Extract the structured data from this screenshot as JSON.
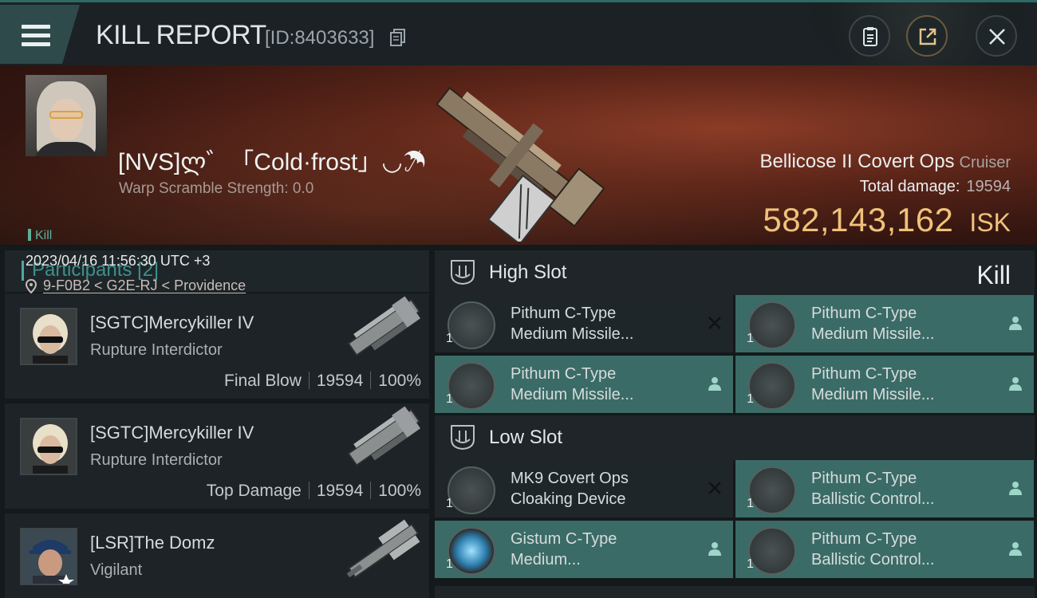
{
  "header": {
    "title": "KILL REPORT",
    "report_id": "[ID:8403633]",
    "menu_icon": "hamburger-menu-icon",
    "buttons": [
      "clipboard-icon",
      "share-icon",
      "close-icon"
    ]
  },
  "victim": {
    "name": "[NVS]ლ゛「Cold·frost」◡☂",
    "warp_scramble": "Warp Scramble Strength: 0.0",
    "type_tag": "Kill",
    "datetime": "2023/04/16 11:56:30 UTC +3",
    "location": "9-F0B2 < G2E-RJ < Providence",
    "ship": "Bellicose II Covert Ops",
    "ship_class": "Cruiser",
    "total_damage_label": "Total damage:",
    "total_damage": "19594",
    "isk_value": "582,143,162",
    "isk_unit": "ISK",
    "result": "Kill"
  },
  "participants": {
    "label": "Participants",
    "count": "[2]",
    "items": [
      {
        "name": "[SGTC]Mercykiller IV",
        "ship": "Rupture Interdictor",
        "tag": "Final Blow",
        "damage": "19594",
        "percent": "100%"
      },
      {
        "name": "[SGTC]Mercykiller IV",
        "ship": "Rupture Interdictor",
        "tag": "Top Damage",
        "damage": "19594",
        "percent": "100%"
      },
      {
        "name": "[LSR]The Domz",
        "ship": "Vigilant"
      }
    ]
  },
  "slots": {
    "high": {
      "label": "High Slot",
      "modules": [
        {
          "line1": "Pithum C-Type",
          "line2": "Medium Missile...",
          "qty": "1",
          "action": "close-x-icon"
        },
        {
          "line1": "Pithum C-Type",
          "line2": "Medium Missile...",
          "qty": "1",
          "action": "person-icon"
        },
        {
          "line1": "Pithum C-Type",
          "line2": "Medium Missile...",
          "qty": "1",
          "action": "person-icon"
        },
        {
          "line1": "Pithum C-Type",
          "line2": "Medium Missile...",
          "qty": "1",
          "action": "person-icon"
        }
      ]
    },
    "low": {
      "label": "Low Slot",
      "modules": [
        {
          "line1": "MK9 Covert Ops",
          "line2": "Cloaking Device",
          "qty": "1",
          "action": "close-x-icon"
        },
        {
          "line1": "Pithum C-Type",
          "line2": "Ballistic Control...",
          "qty": "1",
          "action": "person-icon"
        },
        {
          "line1": "Gistum C-Type",
          "line2": "Medium...",
          "qty": "1",
          "action": "person-icon"
        },
        {
          "line1": "Pithum C-Type",
          "line2": "Ballistic Control...",
          "qty": "1",
          "action": "person-icon"
        }
      ]
    }
  }
}
